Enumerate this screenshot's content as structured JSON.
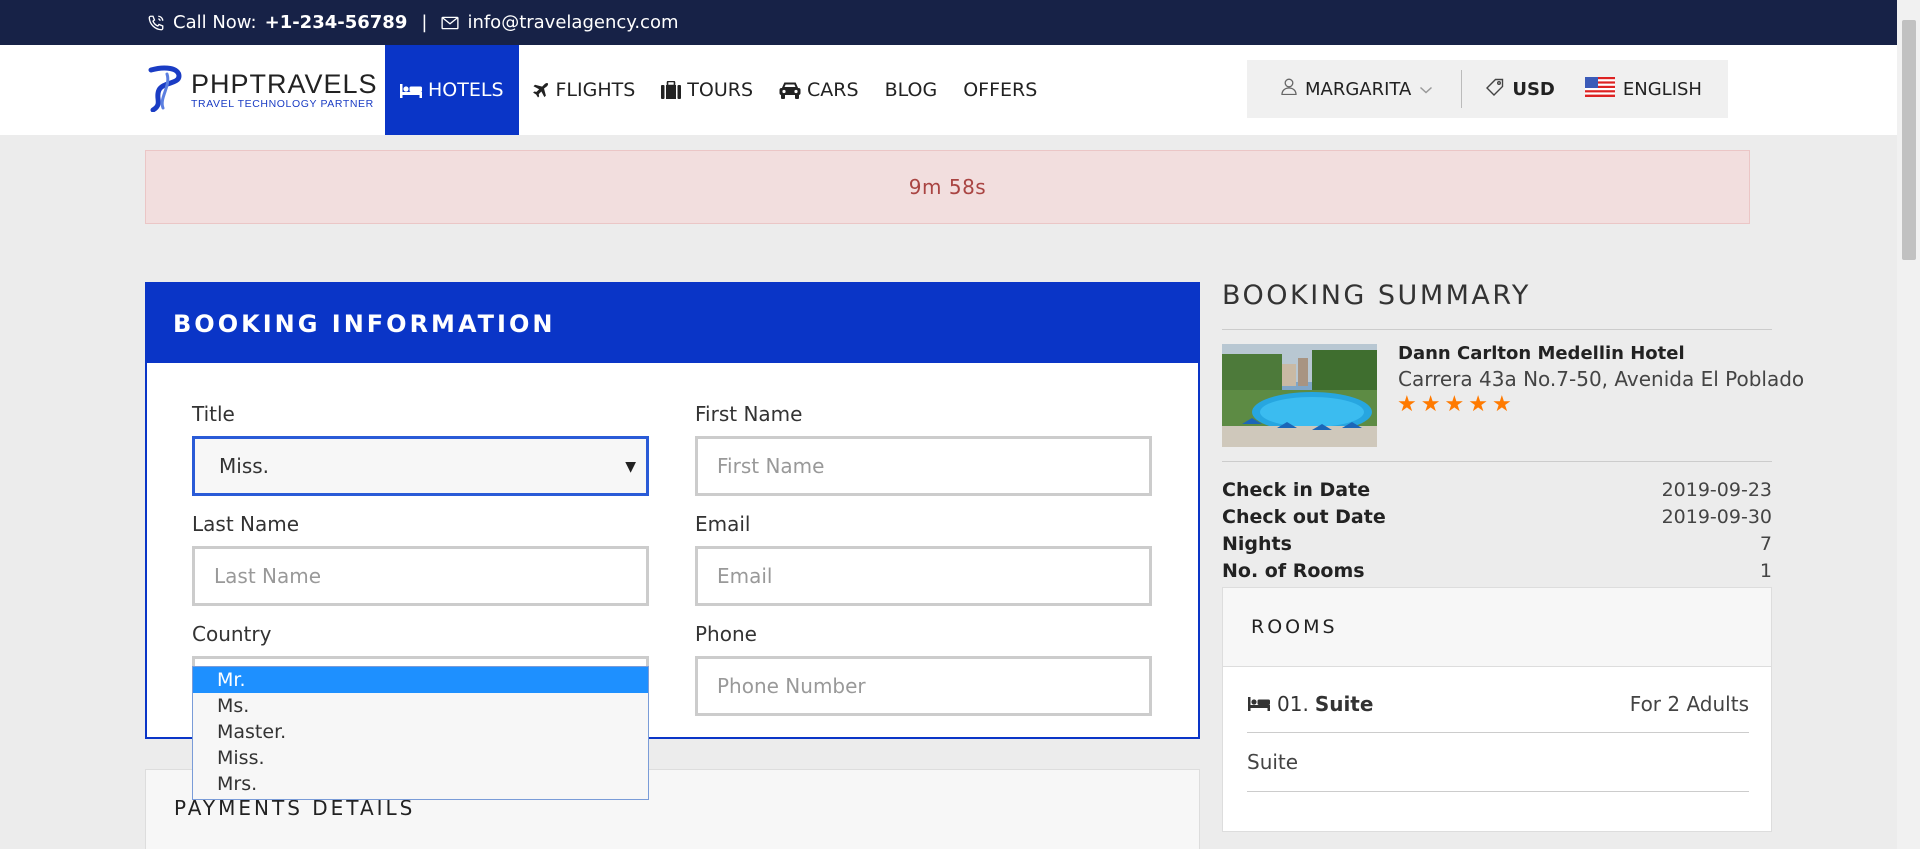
{
  "topbar": {
    "call_label": "Call Now:",
    "phone": "+1-234-56789",
    "separator": "|",
    "email": "info@travelagency.com"
  },
  "nav": {
    "logo_title": "PHPTRAVELS",
    "logo_subtitle": "TRAVEL TECHNOLOGY PARTNER",
    "items": [
      {
        "label": "HOTELS",
        "icon": "bed-icon",
        "active": true
      },
      {
        "label": "FLIGHTS",
        "icon": "plane-icon"
      },
      {
        "label": "TOURS",
        "icon": "suitcase-icon"
      },
      {
        "label": "CARS",
        "icon": "car-icon"
      },
      {
        "label": "BLOG"
      },
      {
        "label": "OFFERS"
      }
    ],
    "user": "MARGARITA",
    "currency": "USD",
    "language": "ENGLISH"
  },
  "timer": {
    "text": "9m 58s"
  },
  "booking": {
    "header": "BOOKING INFORMATION",
    "title_label": "Title",
    "title_value": "Miss.",
    "first_name_label": "First Name",
    "first_name_placeholder": "First Name",
    "last_name_label": "Last Name",
    "last_name_placeholder": "Last Name",
    "email_label": "Email",
    "email_placeholder": "Email",
    "country_label": "Country",
    "phone_label": "Phone",
    "phone_placeholder": "Phone Number",
    "title_options": [
      "Mr.",
      "Ms.",
      "Master.",
      "Miss.",
      "Mrs."
    ]
  },
  "payments": {
    "title": "PAYMENTS DETAILS"
  },
  "summary": {
    "title": "BOOKING SUMMARY",
    "hotel_name": "Dann Carlton Medellin Hotel",
    "hotel_address": "Carrera 43a No.7-50, Avenida El Poblado",
    "stars": 5,
    "details": [
      {
        "key": "Check in Date",
        "value": "2019-09-23"
      },
      {
        "key": "Check out Date",
        "value": "2019-09-30"
      },
      {
        "key": "Nights",
        "value": "7"
      },
      {
        "key": "No. of Rooms",
        "value": "1"
      }
    ],
    "rooms_title": "ROOMS",
    "room_number": "01.",
    "room_name": "Suite",
    "room_guests": "For 2 Adults",
    "room_desc": "Suite"
  },
  "colors": {
    "topbar": "#172247",
    "primary": "#0a35c7",
    "star": "#ff7a00",
    "alert_bg": "#f2dede",
    "alert_text": "#a94442",
    "dropdown_highlight": "#1e90ff"
  }
}
